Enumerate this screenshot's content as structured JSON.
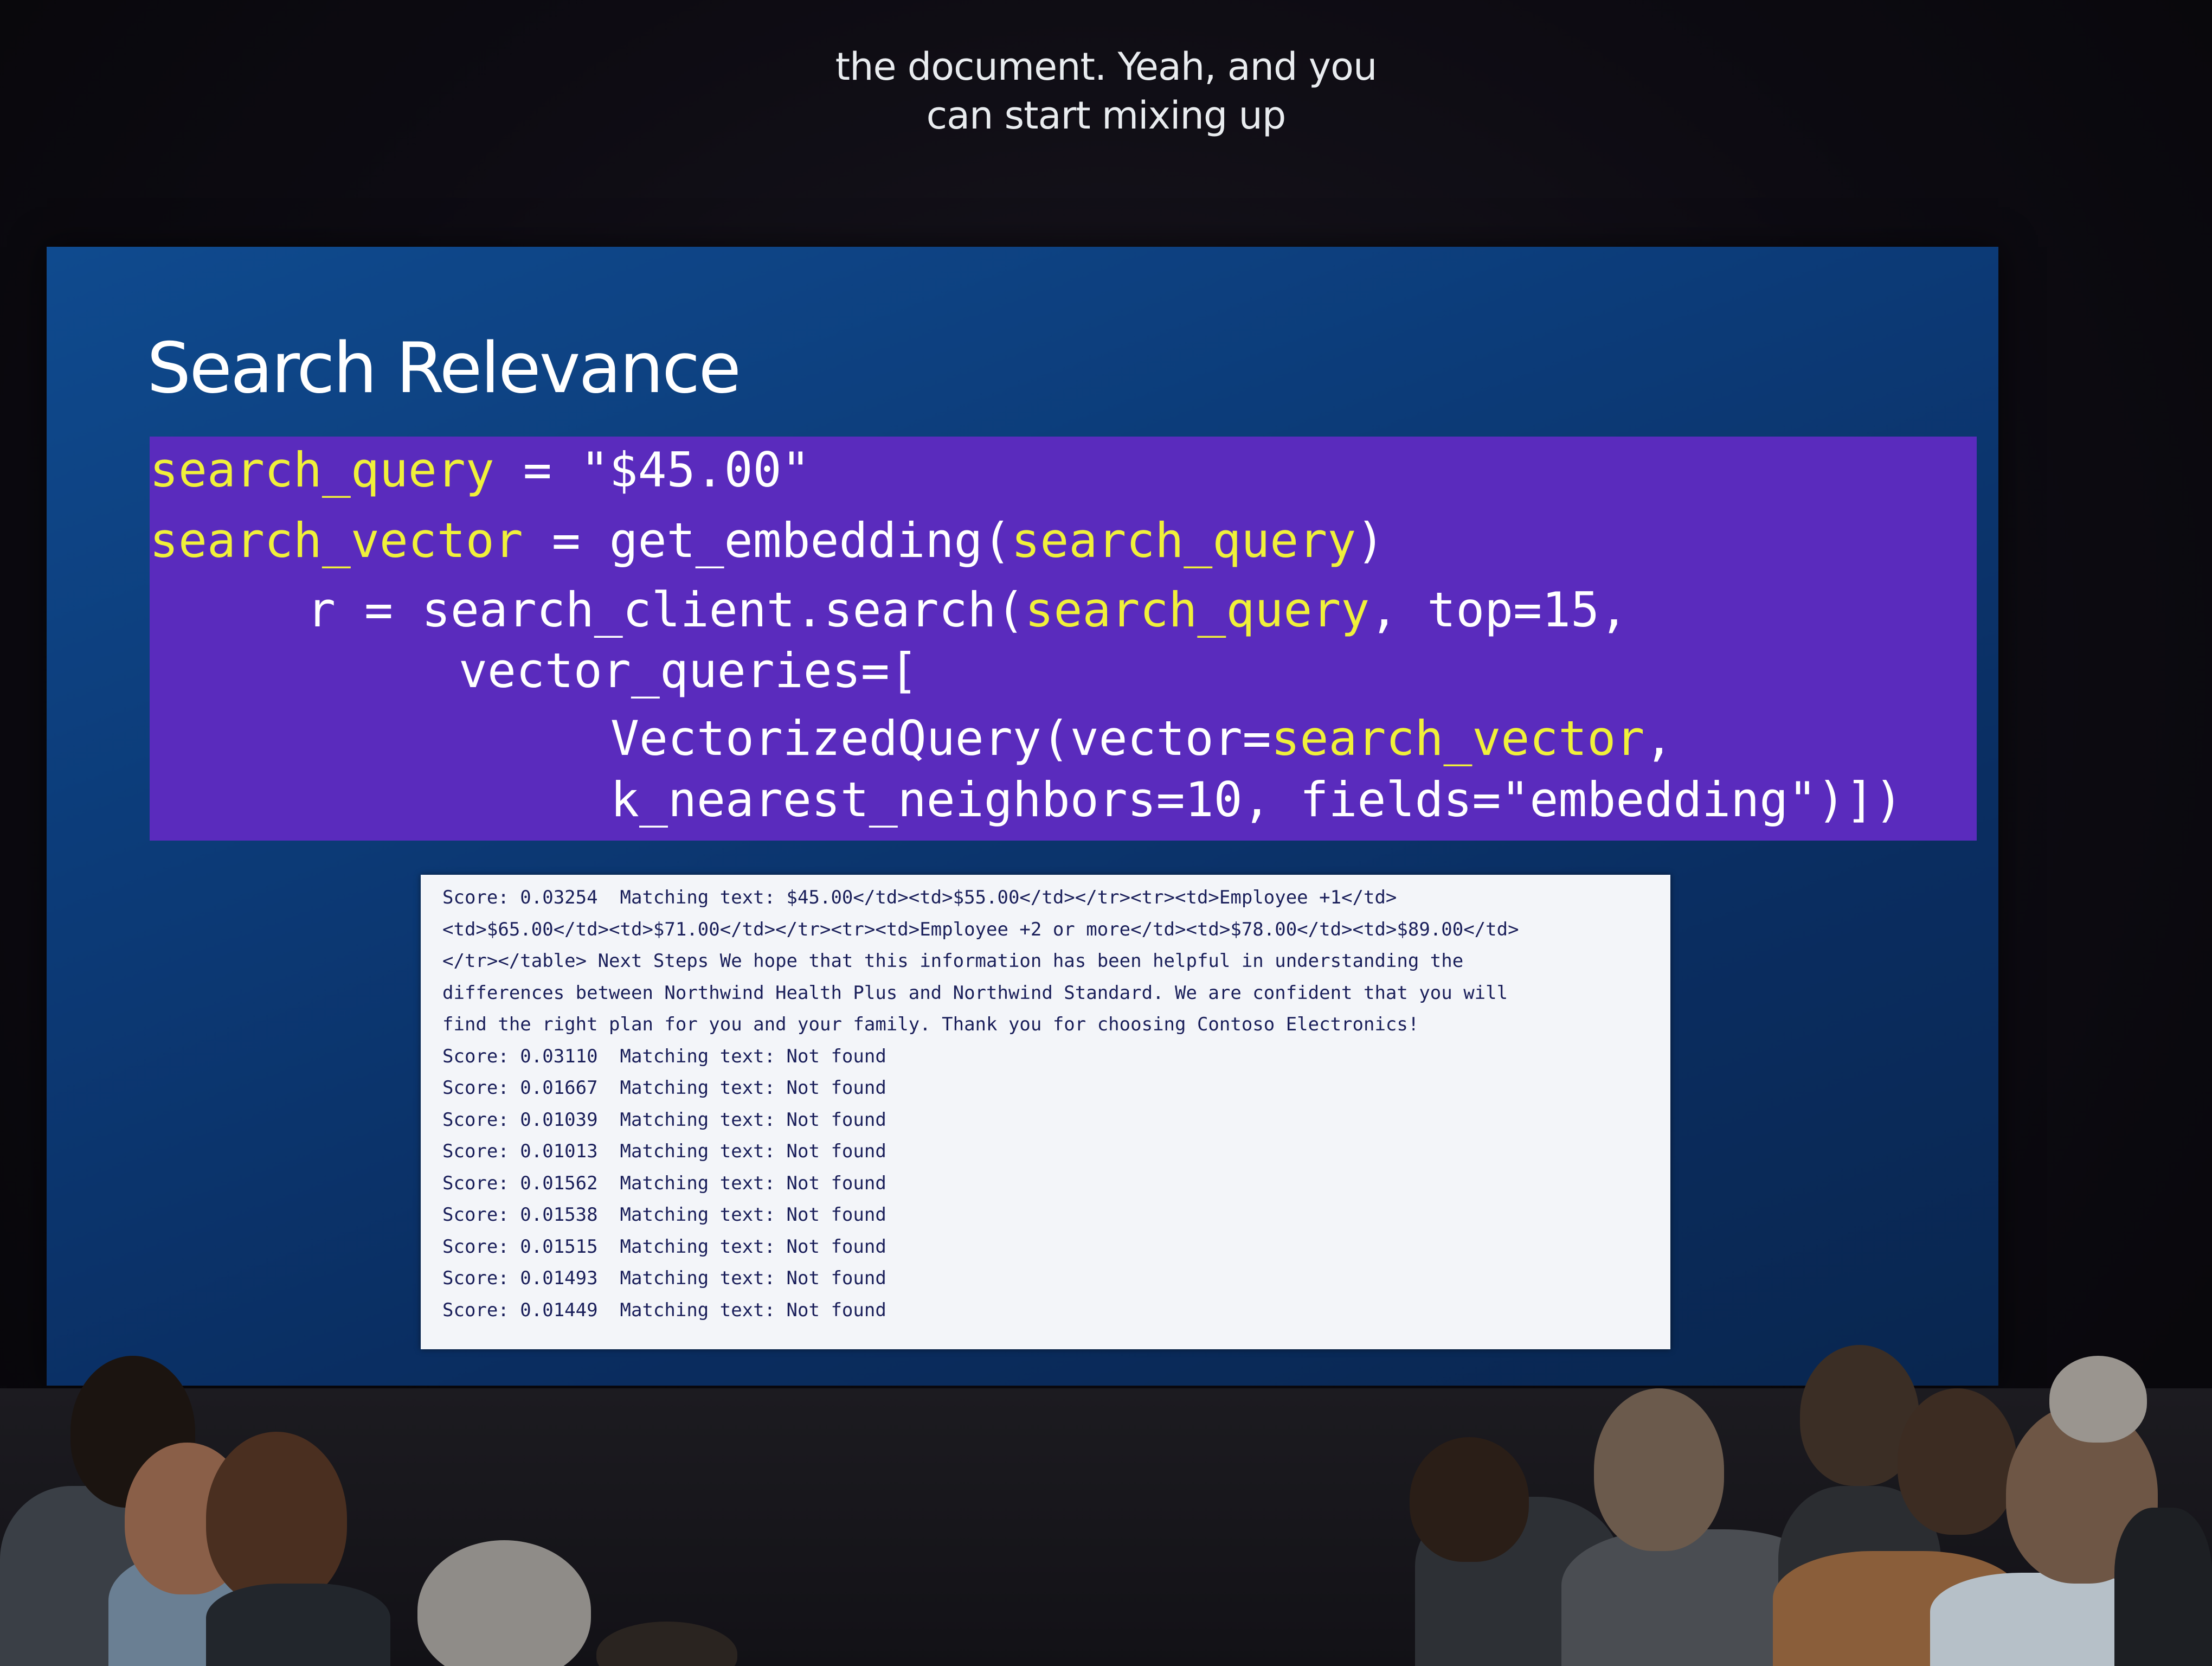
{
  "caption": {
    "line1": "the document. Yeah, and you",
    "line2": "can start mixing up"
  },
  "slide": {
    "title": "Search Relevance",
    "code": {
      "line1": {
        "var": "search_query",
        "rest": " = \"$45.00\""
      },
      "line2": {
        "var": "search_vector",
        "mid": " = get_embedding(",
        "arg": "search_query",
        "end": ")"
      },
      "line3": {
        "pre": "r = search_client.search(",
        "arg": "search_query",
        "end": ", top=15,"
      },
      "line4": {
        "text": "vector_queries=["
      },
      "line5": {
        "pre": "VectorizedQuery(vector=",
        "arg": "search_vector",
        "end": ","
      },
      "line6": {
        "text": "k_nearest_neighbors=10, fields=\"embedding\")])"
      }
    },
    "colors": {
      "background": "#0c3b78",
      "code_background": "#5a2bbd",
      "highlight": "#f0f03a"
    },
    "output_lines": [
      "Score: 0.03254  Matching text: $45.00</td><td>$55.00</td></tr><tr><td>Employee +1</td>",
      "<td>$65.00</td><td>$71.00</td></tr><tr><td>Employee +2 or more</td><td>$78.00</td><td>$89.00</td>",
      "</tr></table> Next Steps We hope that this information has been helpful in understanding the",
      "differences between Northwind Health Plus and Northwind Standard. We are confident that you will",
      "find the right plan for you and your family. Thank you for choosing Contoso Electronics!",
      "Score: 0.03110  Matching text: Not found",
      "Score: 0.01667  Matching text: Not found",
      "Score: 0.01039  Matching text: Not found",
      "Score: 0.01013  Matching text: Not found",
      "Score: 0.01562  Matching text: Not found",
      "Score: 0.01538  Matching text: Not found",
      "Score: 0.01515  Matching text: Not found",
      "Score: 0.01493  Matching text: Not found",
      "Score: 0.01449  Matching text: Not found"
    ]
  }
}
